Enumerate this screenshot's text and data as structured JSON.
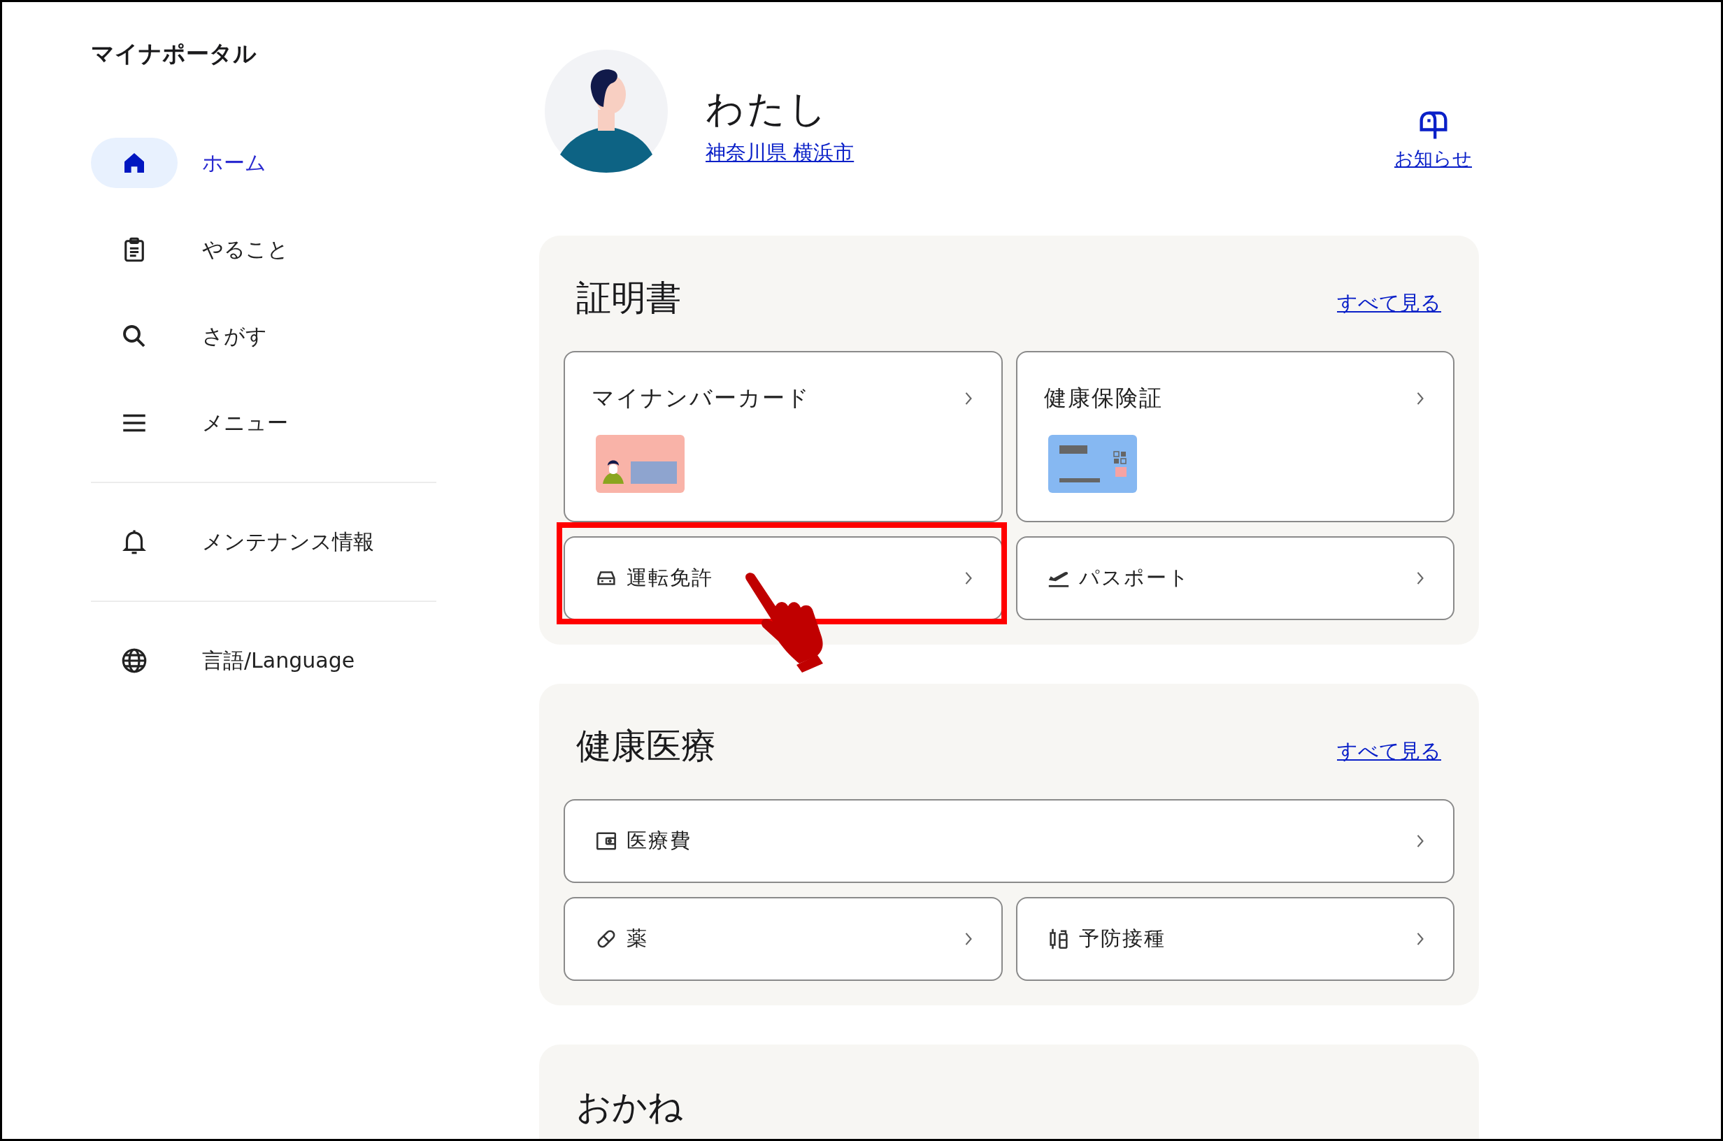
{
  "app_title": "マイナポータル",
  "nav_groups": [
    {
      "items": [
        {
          "label": "ホーム",
          "selected": true
        },
        {
          "label": "やること",
          "selected": false
        },
        {
          "label": "さがす",
          "selected": false
        },
        {
          "label": "メニュー",
          "selected": false
        }
      ]
    },
    {
      "items": [
        {
          "label": "メンテナンス情報",
          "selected": false
        }
      ]
    },
    {
      "items": [
        {
          "label": "言語/Language",
          "selected": false
        }
      ]
    }
  ],
  "profile": {
    "name": "わたし",
    "location": "神奈川県 横浜市"
  },
  "notice": {
    "label": "お知らせ"
  },
  "sections": [
    {
      "title": "証明書",
      "see_all": "すべて見る",
      "tiles": [
        {
          "label": "マイナンバーカード",
          "kind": "picture",
          "highlighted": false
        },
        {
          "label": "健康保険証",
          "kind": "picture",
          "highlighted": false
        },
        {
          "label": "運転免許",
          "kind": "row",
          "highlighted": true
        },
        {
          "label": "パスポート",
          "kind": "row",
          "highlighted": false
        }
      ]
    },
    {
      "title": "健康医療",
      "see_all": "すべて見る",
      "tiles": [
        {
          "label": "医療費",
          "kind": "wide",
          "highlighted": false
        },
        {
          "label": "薬",
          "kind": "row",
          "highlighted": false
        },
        {
          "label": "予防接種",
          "kind": "row",
          "highlighted": false
        }
      ]
    },
    {
      "title": "おかね"
    }
  ]
}
